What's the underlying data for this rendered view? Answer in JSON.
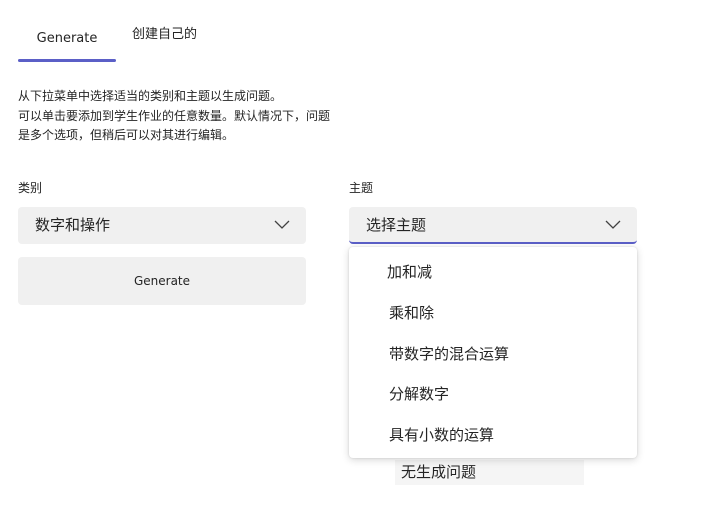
{
  "tabs": [
    {
      "label": "Generate",
      "selected": true
    },
    {
      "label": "创建自己的",
      "selected": false
    }
  ],
  "description": [
    "从下拉菜单中选择适当的类别和主题以生成问题。",
    "可以单击要添加到学生作业的任意数量。默认情况下，问题",
    "是多个选项，但稍后可以对其进行编辑。"
  ],
  "category": {
    "label": "类别",
    "value": "数字和操作"
  },
  "topic": {
    "label": "主题",
    "placeholder": "选择主题",
    "options": [
      "加和减",
      "乘和除",
      "带数字的混合运算",
      "分解数字",
      "具有小数的运算"
    ]
  },
  "generate_button": "Generate",
  "no_question_text": "无生成问题",
  "colors": {
    "accent": "#5b5fc7",
    "field_bg": "#f0f0f0"
  }
}
